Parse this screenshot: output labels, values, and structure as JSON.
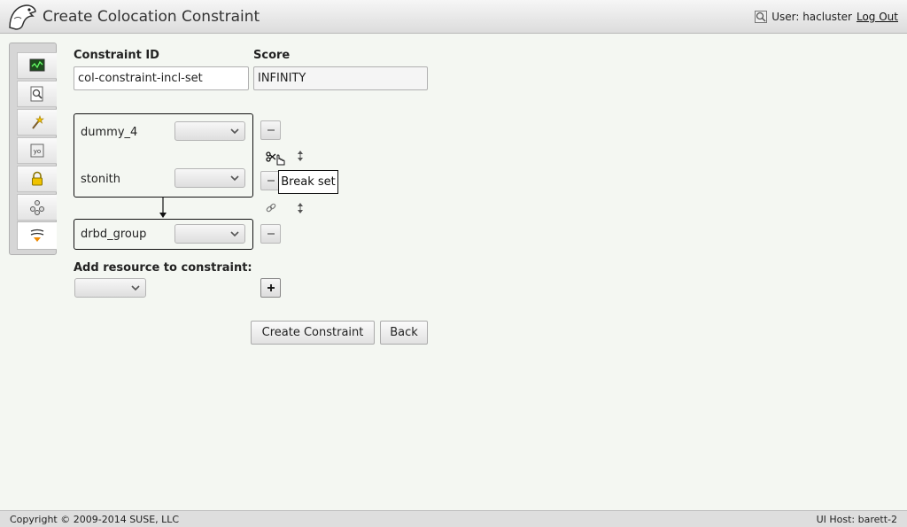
{
  "header": {
    "title": "Create Colocation Constraint",
    "user_label": "User: hacluster",
    "logout": "Log Out"
  },
  "sidebar": {
    "items": [
      {
        "icon": "monitor-icon",
        "active": false
      },
      {
        "icon": "history-explorer-icon",
        "active": false
      },
      {
        "icon": "wizard-icon",
        "active": false
      },
      {
        "icon": "config-icon",
        "active": false
      },
      {
        "icon": "lock-icon",
        "active": false
      },
      {
        "icon": "cluster-nodes-icon",
        "active": false
      },
      {
        "icon": "constraints-icon",
        "active": true
      }
    ]
  },
  "form": {
    "constraint_id_label": "Constraint ID",
    "constraint_id_value": "col-constraint-incl-set",
    "score_label": "Score",
    "score_value": "INFINITY",
    "sets": [
      {
        "resources": [
          "dummy_4",
          "stonith"
        ]
      },
      {
        "resources": [
          "drbd_group"
        ]
      }
    ],
    "tooltip": "Break set",
    "add_resource_label": "Add resource to constraint:",
    "create_button": "Create Constraint",
    "back_button": "Back"
  },
  "footer": {
    "copyright": "Copyright © 2009-2014 SUSE, LLC",
    "host": "UI Host: barett-2"
  },
  "colors": {
    "background": "#f4f7f2",
    "header": "#dcdcdc",
    "border": "#111111"
  }
}
